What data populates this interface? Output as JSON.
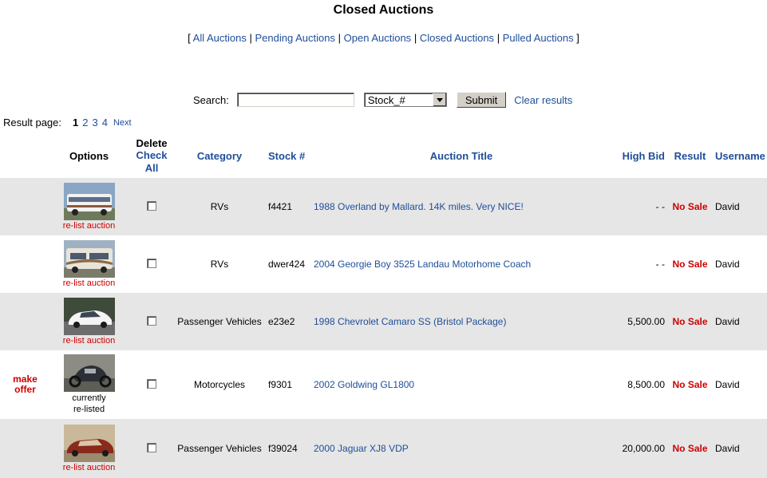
{
  "page": {
    "title": "Closed Auctions"
  },
  "nav": {
    "open_bracket": "[",
    "close_bracket": "]",
    "separator": "|",
    "links": [
      "All Auctions",
      "Pending Auctions",
      "Open Auctions",
      "Closed Auctions",
      "Pulled Auctions"
    ]
  },
  "search": {
    "label": "Search:",
    "value": "",
    "field_selected": "Stock_#",
    "submit_label": "Submit",
    "clear_label": "Clear results"
  },
  "pager": {
    "label": "Result page:",
    "current": "1",
    "pages": [
      "2",
      "3",
      "4"
    ],
    "next_label": "Next"
  },
  "table": {
    "headers": {
      "options": "Options",
      "delete": "Delete",
      "check_all": "Check All",
      "category": "Category",
      "stock": "Stock #",
      "auction_title": "Auction Title",
      "high_bid": "High Bid",
      "result": "Result",
      "username": "Username"
    },
    "rows": [
      {
        "offer": "",
        "thumb": "rv-1-thumbnail",
        "option": "re-list auction",
        "option_type": "relist",
        "category": "RVs",
        "stock": "f4421",
        "title": "1988 Overland by Mallard. 14K miles. Very NICE!",
        "high_bid": "- -",
        "result": "No Sale",
        "username": "David"
      },
      {
        "offer": "",
        "thumb": "rv-2-thumbnail",
        "option": "re-list auction",
        "option_type": "relist",
        "category": "RVs",
        "stock": "dwer424",
        "title": "2004 Georgie Boy 3525 Landau Motorhome Coach",
        "high_bid": "- -",
        "result": "No Sale",
        "username": "David"
      },
      {
        "offer": "",
        "thumb": "car-camaro-thumbnail",
        "option": "re-list auction",
        "option_type": "relist",
        "category": "Passenger Vehicles",
        "stock": "e23e2",
        "title": "1998 Chevrolet Camaro SS (Bristol Package)",
        "high_bid": "5,500.00",
        "result": "No Sale",
        "username": "David"
      },
      {
        "offer": "make offer",
        "thumb": "motorcycle-thumbnail",
        "option": "currently re-listed",
        "option_type": "relisted",
        "category": "Motorcycles",
        "stock": "f9301",
        "title": "2002 Goldwing GL1800",
        "high_bid": "8,500.00",
        "result": "No Sale",
        "username": "David"
      },
      {
        "offer": "",
        "thumb": "car-jaguar-thumbnail",
        "option": "re-list auction",
        "option_type": "relist",
        "category": "Passenger Vehicles",
        "stock": "f39024",
        "title": "2000 Jaguar XJ8 VDP",
        "high_bid": "20,000.00",
        "result": "No Sale",
        "username": "David"
      }
    ]
  },
  "colors": {
    "link": "#1f4e99",
    "alert_red": "#cc0000",
    "row_shade": "#e6e6e6"
  }
}
